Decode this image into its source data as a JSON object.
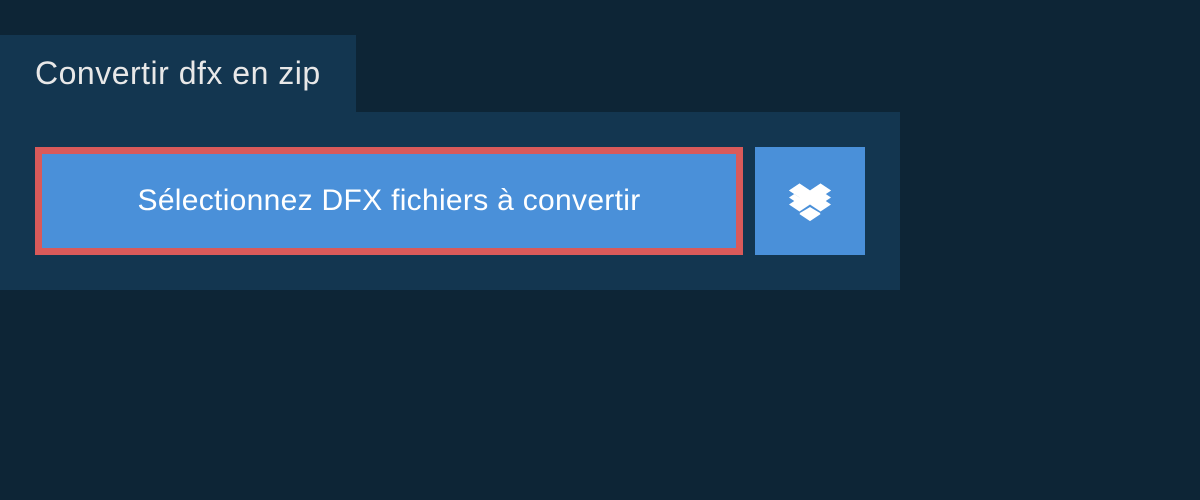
{
  "tab": {
    "label": "Convertir dfx en zip"
  },
  "upload": {
    "select_button_label": "Sélectionnez DFX fichiers à convertir",
    "dropbox_button_name": "dropbox"
  },
  "colors": {
    "background": "#0d2536",
    "panel": "#133650",
    "button": "#4a90d9",
    "highlight_border": "#d95a5a"
  }
}
